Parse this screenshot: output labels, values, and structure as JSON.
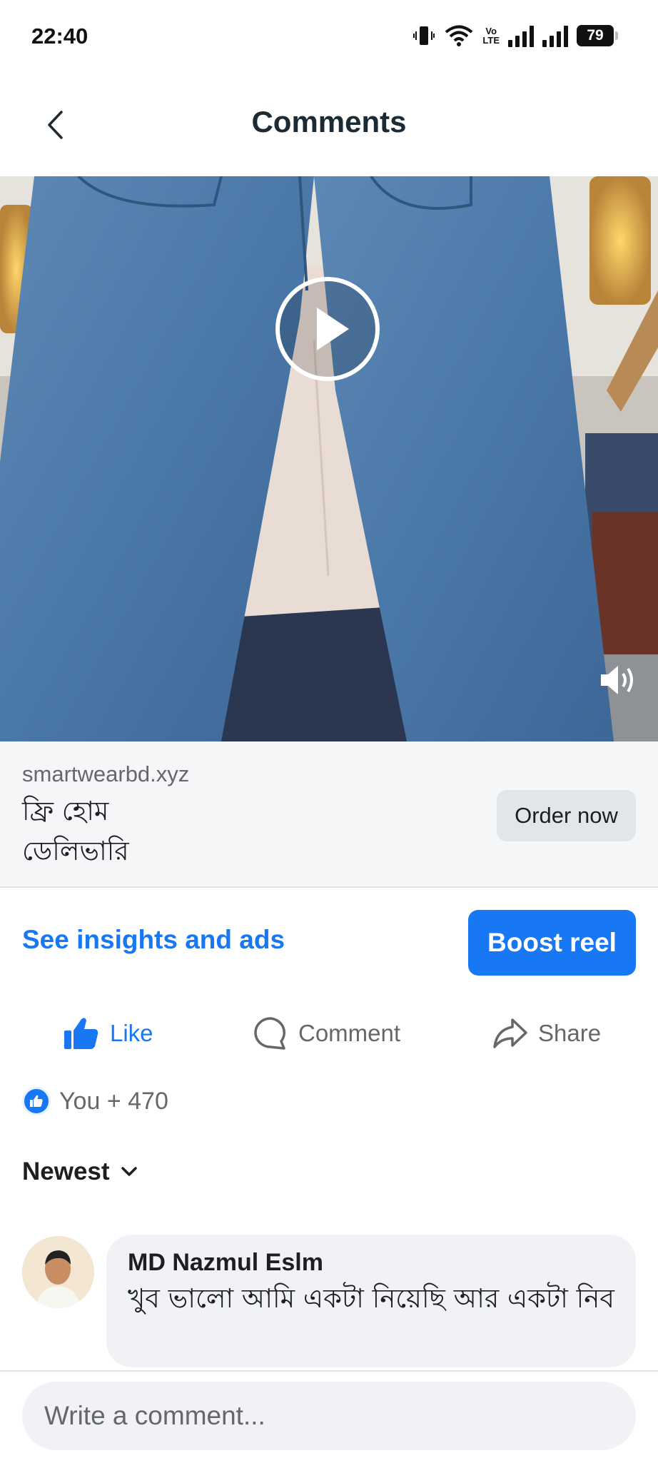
{
  "status_bar": {
    "time": "22:40",
    "volte_top": "Vo",
    "volte_bottom": "LTE",
    "battery": "79"
  },
  "header": {
    "title": "Comments"
  },
  "ad": {
    "domain": "smartwearbd.xyz",
    "text_line1": "ফ্রি হোম",
    "text_line2": "ডেলিভারি",
    "cta_label": "Order now"
  },
  "insights": {
    "link_label": "See insights and ads",
    "boost_label": "Boost reel"
  },
  "actions": {
    "like_label": "Like",
    "comment_label": "Comment",
    "share_label": "Share"
  },
  "reactions": {
    "summary": "You + 470"
  },
  "sort": {
    "label": "Newest"
  },
  "comments": [
    {
      "author": "MD Nazmul Eslm",
      "text": "খুব ভালো আমি একটা নিয়েছি আর একটা নিব"
    }
  ],
  "composer": {
    "placeholder": "Write a comment..."
  },
  "colors": {
    "accent": "#1877f2",
    "denim": "#4a78a8",
    "bubble": "#f0f2f5"
  }
}
